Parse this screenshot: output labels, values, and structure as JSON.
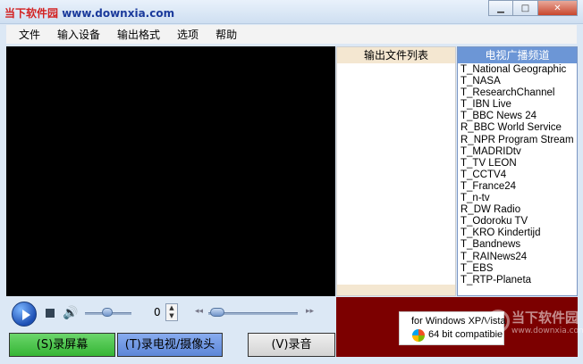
{
  "titlebar": {
    "logo_brand": "当下软件园",
    "logo_url": "www.downxia.com"
  },
  "menu": [
    "文件",
    "输入设备",
    "输出格式",
    "选项",
    "帮助"
  ],
  "output_panel": {
    "header": "输出文件列表"
  },
  "channel_panel": {
    "header": "电视广播频道",
    "channels": [
      "T_National Geographic",
      "T_NASA",
      "T_ResearchChannel",
      "T_IBN Live",
      "T_BBC News 24",
      "R_BBC World Service",
      "R_NPR Program Stream",
      "T_MADRIDtv",
      "T_TV LEON",
      "T_CCTV4",
      "T_France24",
      "T_n-tv",
      "R_DW Radio",
      "T_Odoroku TV",
      "T_KRO Kindertijd",
      "T_Bandnews",
      "T_RAINews24",
      "T_EBS",
      "T_RTP-Planeta"
    ]
  },
  "controls": {
    "counter": "0"
  },
  "buttons": {
    "record_screen": "(S)录屏幕",
    "record_tv": "(T)录电视/摄像头",
    "record_audio": "(V)录音"
  },
  "compat": {
    "line1": "for Windows XP/Vista",
    "line2": "64 bit compatible"
  },
  "watermark": {
    "text": "当下软件园",
    "url": "www.downxia.com"
  }
}
